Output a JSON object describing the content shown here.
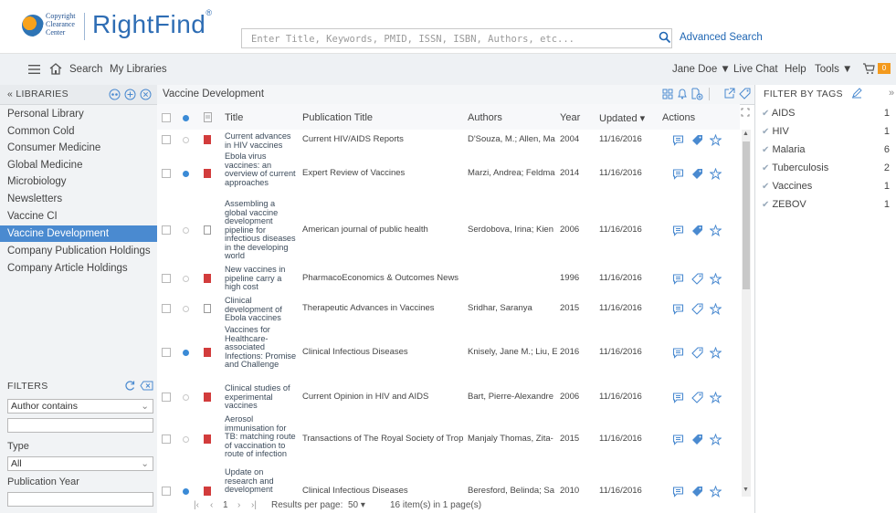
{
  "brand": {
    "logo_lines": [
      "Copyright",
      "Clearance",
      "Center"
    ],
    "name": "RightFind",
    "mark": "®"
  },
  "search": {
    "placeholder": "Enter Title, Keywords, PMID, ISSN, ISBN, Authors, etc...",
    "advanced_label": "Advanced Search"
  },
  "nav": {
    "search": "Search",
    "my_libraries": "My Libraries",
    "user": "Jane Doe ▼",
    "live_chat": "Live Chat",
    "help": "Help",
    "tools": "Tools ▼",
    "cart_count": "0"
  },
  "libraries": {
    "title": "« LIBRARIES",
    "items": [
      "Personal Library",
      "Common Cold",
      "Consumer Medicine",
      "Global Medicine",
      "Microbiology",
      "Newsletters",
      "Vaccine CI",
      "Vaccine Development",
      "Company Publication Holdings",
      "Company Article Holdings"
    ],
    "selected_index": 7
  },
  "filters": {
    "title": "FILTERS",
    "author_select": "Author contains",
    "type_label": "Type",
    "type_select": "All",
    "year_label": "Publication Year"
  },
  "center": {
    "title": "Vaccine Development",
    "columns": {
      "title": "Title",
      "publication": "Publication Title",
      "authors": "Authors",
      "year": "Year",
      "updated": "Updated ▾",
      "actions": "Actions"
    },
    "rows": [
      {
        "title": "Current advances in HIV vaccines",
        "publication": "Current HIV/AIDS Reports",
        "authors": "D'Souza, M.; Allen, Ma",
        "year": "2004",
        "updated": "11/16/2016",
        "dot": false,
        "file": "pdf",
        "tagged": true
      },
      {
        "title": "Ebola virus vaccines: an overview of current approaches",
        "publication": "Expert Review of Vaccines",
        "authors": "Marzi, Andrea; Feldma",
        "year": "2014",
        "updated": "11/16/2016",
        "dot": true,
        "file": "pdf",
        "tagged": true
      },
      {
        "title": "Assembling a global vaccine development pipeline for infectious diseases in the developing world",
        "publication": "American journal of public health",
        "authors": "Serdobova, Irina; Kien",
        "year": "2006",
        "updated": "11/16/2016",
        "dot": false,
        "file": "doc",
        "tagged": true
      },
      {
        "title": "New vaccines in pipeline carry a high cost",
        "publication": "PharmacoEconomics & Outcomes News",
        "authors": "",
        "year": "1996",
        "updated": "11/16/2016",
        "dot": false,
        "file": "pdf",
        "tagged": false
      },
      {
        "title": "Clinical development of Ebola vaccines",
        "publication": "Therapeutic Advances in Vaccines",
        "authors": "Sridhar, Saranya",
        "year": "2015",
        "updated": "11/16/2016",
        "dot": false,
        "file": "doc",
        "tagged": false
      },
      {
        "title": "Vaccines for Healthcare-associated Infections: Promise and Challenge",
        "publication": "Clinical Infectious Diseases",
        "authors": "Knisely, Jane M.; Liu, E",
        "year": "2016",
        "updated": "11/16/2016",
        "dot": true,
        "file": "pdf",
        "tagged": false
      },
      {
        "title": "Clinical studies of experimental vaccines",
        "publication": "Current Opinion in HIV and AIDS",
        "authors": "Bart, Pierre-Alexandre",
        "year": "2006",
        "updated": "11/16/2016",
        "dot": false,
        "file": "pdf",
        "tagged": false
      },
      {
        "title": "Aerosol immunisation for TB: matching route of vaccination to route of infection",
        "publication": "Transactions of The Royal Society of Trop",
        "authors": "Manjaly Thomas, Zita-",
        "year": "2015",
        "updated": "11/16/2016",
        "dot": false,
        "file": "pdf",
        "tagged": true
      },
      {
        "title": "Update on research and development",
        "publication": "Clinical Infectious Diseases",
        "authors": "Beresford, Belinda; Sa",
        "year": "2010",
        "updated": "11/16/2016",
        "dot": true,
        "file": "pdf",
        "tagged": true
      }
    ]
  },
  "pager": {
    "first": "|‹",
    "prev": "‹",
    "page": "1",
    "next": "›",
    "last": "›|",
    "per_page_label": "Results per page:",
    "per_page": "50 ▾",
    "summary": "16 item(s) in 1 page(s)"
  },
  "tags": {
    "title": "FILTER BY TAGS",
    "items": [
      {
        "name": "AIDS",
        "count": "1"
      },
      {
        "name": "HIV",
        "count": "1"
      },
      {
        "name": "Malaria",
        "count": "6"
      },
      {
        "name": "Tuberculosis",
        "count": "2"
      },
      {
        "name": "Vaccines",
        "count": "1"
      },
      {
        "name": "ZEBOV",
        "count": "1"
      }
    ]
  },
  "colors": {
    "accent": "#4a8ad0",
    "brand": "#2e6db4",
    "badge": "#f39a1e"
  }
}
